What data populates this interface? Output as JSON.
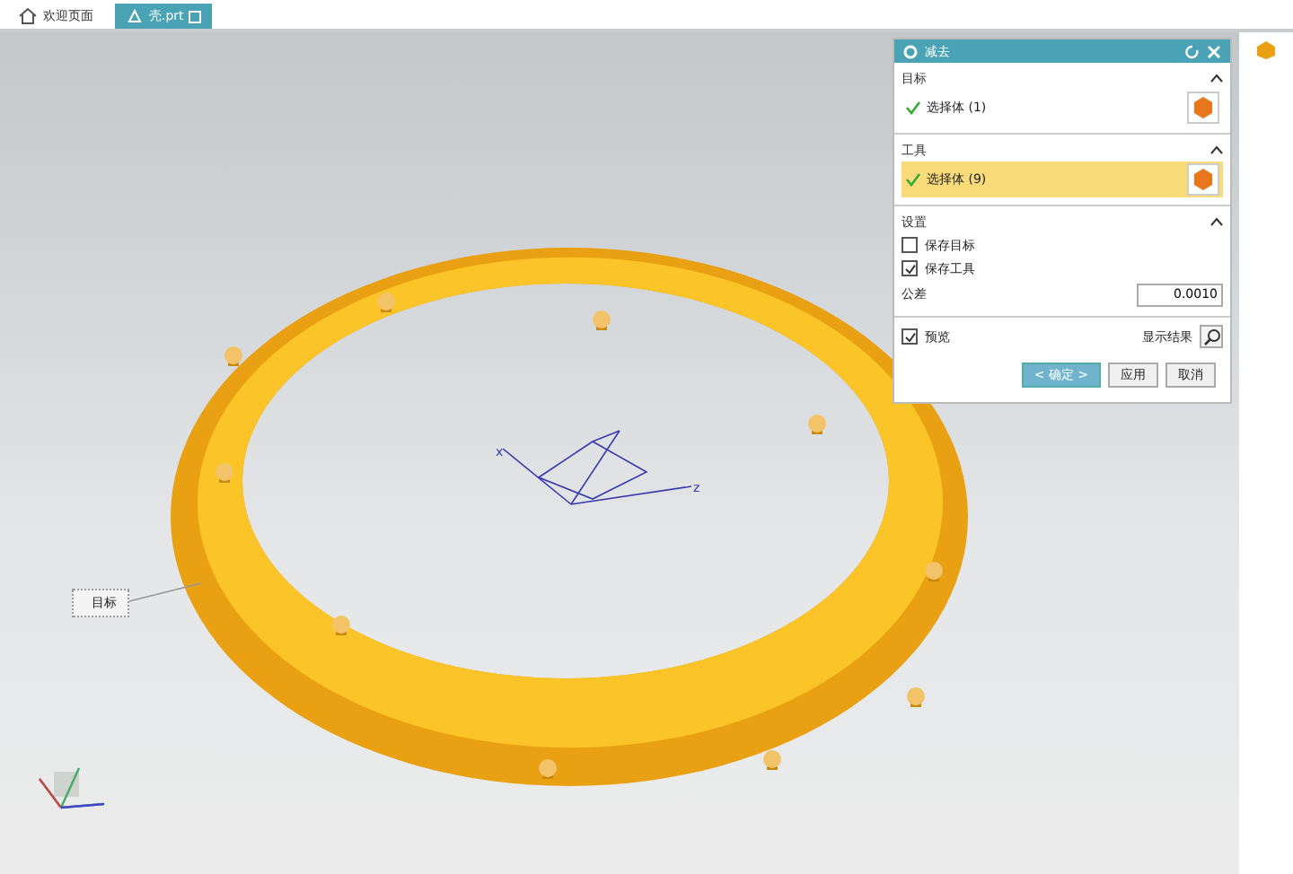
{
  "tabs": [
    {
      "label": "欢迎页面",
      "selected": false
    },
    {
      "label": "壳.prt",
      "selected": true
    }
  ],
  "viewport": {
    "callout": "目标",
    "axis_labels": [
      "x",
      "z"
    ]
  },
  "dialog": {
    "title": "减去",
    "sections": [
      {
        "title": "目标",
        "kind": "selection",
        "label": "选择体 (1)",
        "selected": false
      },
      {
        "title": "工具",
        "kind": "selection",
        "label": "选择体 (9)",
        "selected": true
      },
      {
        "title": "设置",
        "kind": "settings",
        "checkboxes": [
          {
            "label": "保存目标",
            "checked": false
          },
          {
            "label": "保存工具",
            "checked": true
          }
        ],
        "tolerance": {
          "label": "公差",
          "value": "0.0010"
        }
      }
    ],
    "preview": {
      "label": "预览",
      "checked": true
    },
    "show_result": "显示结果",
    "buttons": [
      {
        "label": "< 确定 >",
        "kind": "primary"
      },
      {
        "label": "应用",
        "kind": "normal"
      },
      {
        "label": "取消",
        "kind": "normal"
      }
    ]
  }
}
